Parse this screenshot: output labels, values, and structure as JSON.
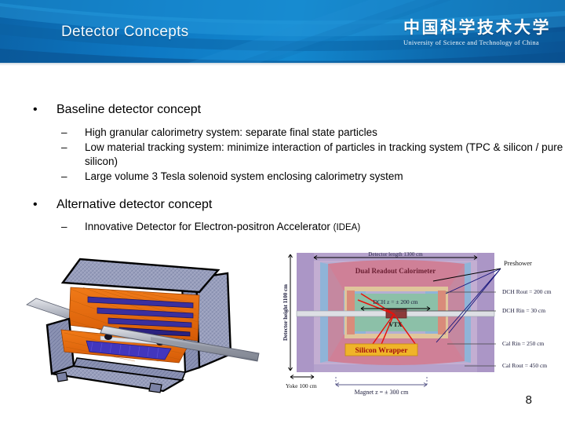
{
  "slide": {
    "title": "Detector Concepts",
    "page_number": "8"
  },
  "logo": {
    "chinese_name": "中国科学技术大学",
    "english_name": "University of Science and Technology of China",
    "seal_icon": "ustc-seal-icon"
  },
  "body": {
    "bullets": [
      {
        "marker": "•",
        "text": "Baseline detector concept",
        "sub": [
          {
            "marker": "–",
            "text": "High granular calorimetry system: separate final state particles"
          },
          {
            "marker": "–",
            "text": "Low material tracking system: minimize interaction of particles in tracking system (TPC & silicon / pure silicon)"
          },
          {
            "marker": "–",
            "text": "Large volume 3 Tesla solenoid system enclosing calorimetry system"
          }
        ]
      },
      {
        "marker": "•",
        "text": "Alternative detector concept",
        "sub": [
          {
            "marker": "–",
            "text": "Innovative Detector for Electron-positron Accelerator ",
            "suffix": "(IDEA)"
          }
        ]
      }
    ]
  },
  "figures": {
    "detector_3d": {
      "caption": "cutaway-3d-detector-rendering",
      "colors": {
        "yoke": "#9aa0bd",
        "interior": "#ec6c10",
        "inner_plates": "#4b3fb4",
        "beam_pipe": "#b9bcc6",
        "outline": "#000000"
      }
    },
    "idea_section": {
      "colors": {
        "yoke": "#b09ec9",
        "magnet": "#8fb5d8",
        "calorimeter": "#d4879c",
        "tracker": "#8cc0a8",
        "preshower_bar": "#d98b7a",
        "background": "#c3aed2",
        "tracks": "#e8120c",
        "wrapper_box": "#f0b429",
        "label_red": "#a31010"
      },
      "labels": {
        "detector_height": "Detector height 1100 cm",
        "detector_length": "Detector length 1300 cm",
        "calorimeter": "Dual Readout Calorimeter",
        "preshower": "Preshower",
        "dch_rout": "DCH Rout = 200 cm",
        "dch_rin": "DCH Rin =  30 cm",
        "cal_rin": "Cal Rin  = 250 cm",
        "cal_rout": "Cal Rout = 450 cm",
        "dch_z": "DCH z = ± 200 cm",
        "vtx": "VTX",
        "silicon_wrapper": "Silicon Wrapper",
        "yoke": "Yoke 100 cm",
        "magnet_z": "Magnet z = ± 300 cm"
      }
    }
  }
}
